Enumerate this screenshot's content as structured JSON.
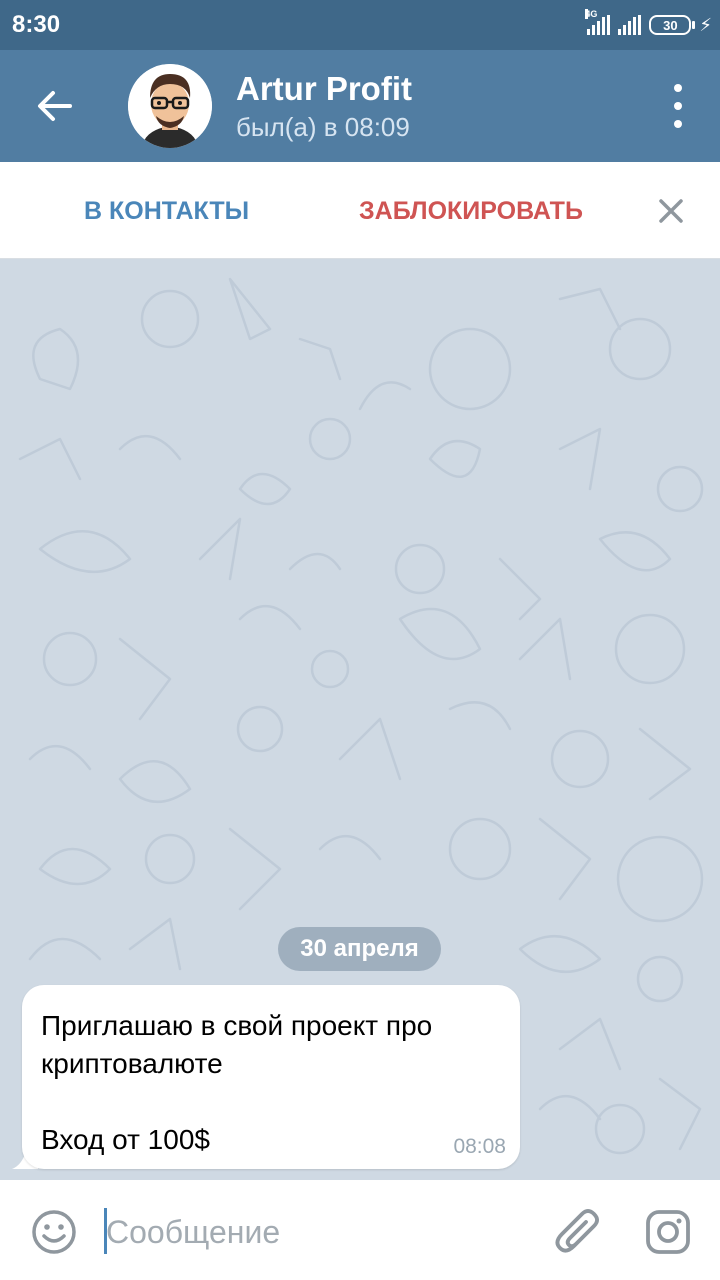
{
  "status_bar": {
    "time": "8:30",
    "network_label": "4G",
    "battery": "30"
  },
  "header": {
    "title": "Artur Profit",
    "status": "был(а) в 08:09"
  },
  "action_bar": {
    "add_contact": "В КОНТАКТЫ",
    "block": "ЗАБЛОКИРОВАТЬ"
  },
  "chat": {
    "date": "30 апреля",
    "messages": [
      {
        "text": "Приглашаю в свой проект про криптовалюте\n\nВход от 100$",
        "time": "08:08"
      }
    ]
  },
  "input": {
    "placeholder": "Сообщение"
  },
  "colors": {
    "header": "#517da2",
    "status_bar": "#3f6889",
    "chat_background": "#cfd9e3",
    "accent": "#4a86b9",
    "danger": "#cf5453"
  }
}
